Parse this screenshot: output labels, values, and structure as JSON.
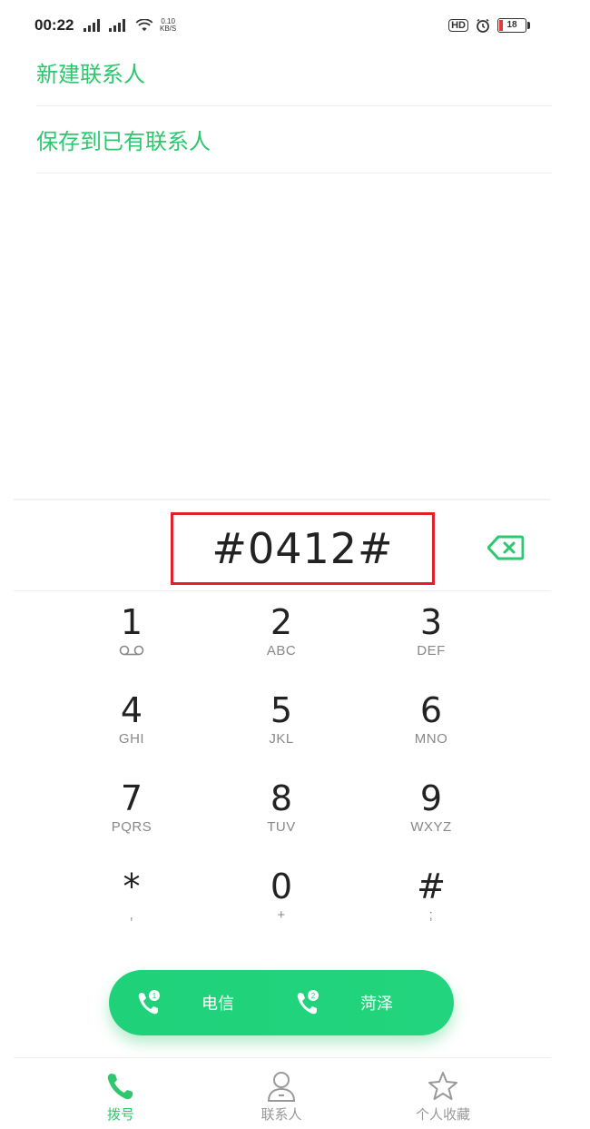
{
  "status_bar": {
    "time": "00:22",
    "net_speed_value": "0.10",
    "net_speed_unit": "KB/S",
    "hd_label": "HD",
    "battery_level": "18",
    "accent_low_battery": "#e53935"
  },
  "menu": {
    "items": [
      {
        "label": "新建联系人"
      },
      {
        "label": "保存到已有联系人"
      }
    ],
    "color": "#2dc76d"
  },
  "dialer": {
    "number": "#0412#",
    "highlight_color": "#e0212b"
  },
  "keypad": {
    "keys": [
      {
        "digit": "1",
        "letters": "",
        "icon": "voicemail-icon"
      },
      {
        "digit": "2",
        "letters": "ABC"
      },
      {
        "digit": "3",
        "letters": "DEF"
      },
      {
        "digit": "4",
        "letters": "GHI"
      },
      {
        "digit": "5",
        "letters": "JKL"
      },
      {
        "digit": "6",
        "letters": "MNO"
      },
      {
        "digit": "7",
        "letters": "PQRS"
      },
      {
        "digit": "8",
        "letters": "TUV"
      },
      {
        "digit": "9",
        "letters": "WXYZ"
      },
      {
        "digit": "*",
        "letters": ","
      },
      {
        "digit": "0",
        "letters": "+"
      },
      {
        "digit": "#",
        "letters": ";"
      }
    ]
  },
  "call_buttons": [
    {
      "label": "电信",
      "sim": "1",
      "icon": "phone-sim1-icon"
    },
    {
      "label": "菏泽",
      "sim": "2",
      "icon": "phone-sim2-icon"
    }
  ],
  "bottom_nav": {
    "items": [
      {
        "label": "拨号",
        "icon": "phone-icon",
        "active": true
      },
      {
        "label": "联系人",
        "icon": "person-icon",
        "active": false
      },
      {
        "label": "个人收藏",
        "icon": "star-icon",
        "active": false
      }
    ],
    "active_color": "#2dc76d",
    "inactive_color": "#999999"
  }
}
